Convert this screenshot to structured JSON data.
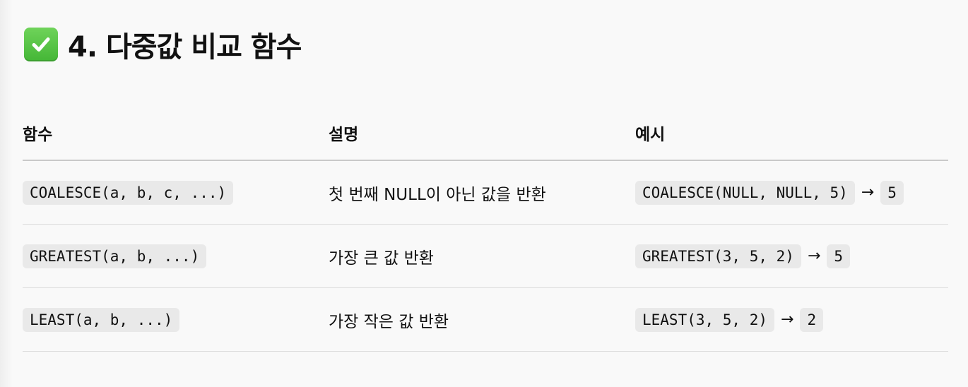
{
  "heading": {
    "icon": "check-mark-button-icon",
    "title": "4. 다중값 비교 함수"
  },
  "table": {
    "headers": [
      "함수",
      "설명",
      "예시"
    ],
    "rows": [
      {
        "function": "COALESCE(a, b, c, ...)",
        "description": "첫 번째 NULL이 아닌 값을 반환",
        "example_expr": "COALESCE(NULL, NULL, 5)",
        "arrow": "→",
        "example_result": "5"
      },
      {
        "function": "GREATEST(a, b, ...)",
        "description": "가장 큰 값 반환",
        "example_expr": "GREATEST(3, 5, 2)",
        "arrow": "→",
        "example_result": "5"
      },
      {
        "function": "LEAST(a, b, ...)",
        "description": "가장 작은 값 반환",
        "example_expr": "LEAST(3, 5, 2)",
        "arrow": "→",
        "example_result": "2"
      }
    ]
  },
  "colors": {
    "check_icon": "#4fc13f",
    "code_bg": "#e9e9e9",
    "rule": "#c9c9c9"
  }
}
